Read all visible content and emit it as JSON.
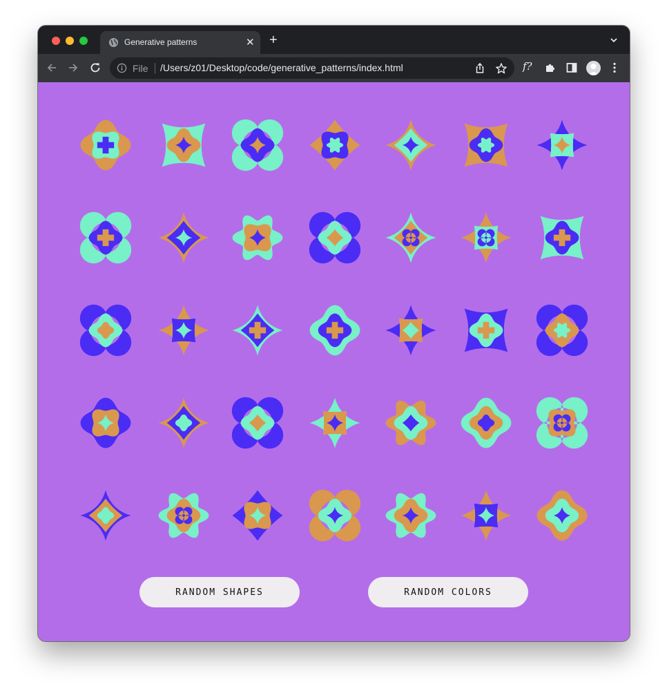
{
  "browser": {
    "tab_title": "Generative patterns",
    "tab_icon": "globe-icon",
    "url_scheme_label": "File",
    "url": "/Users/z01/Desktop/code/generative_patterns/index.html",
    "font_extension_label": "f?"
  },
  "colors": {
    "background": "#b46de9",
    "blue": "#4a2cf5",
    "mint": "#78f0c8",
    "orange": "#d9984e"
  },
  "grid": {
    "rows": 5,
    "columns": 7,
    "patterns": [
      [
        "blob",
        "orange",
        "mint",
        "blue",
        "plus"
      ],
      [
        "square",
        "mint",
        "orange",
        "blue",
        "star"
      ],
      [
        "clover",
        "mint",
        "blue",
        "orange",
        "star"
      ],
      [
        "diamond",
        "orange",
        "blue",
        "mint",
        "flower"
      ],
      [
        "star",
        "orange",
        "mint",
        "blue",
        "star"
      ],
      [
        "square",
        "orange",
        "blue",
        "mint",
        "flower"
      ],
      [
        "star",
        "blue",
        "mint",
        "orange",
        "star"
      ],
      [
        "clover",
        "mint",
        "blue",
        "orange",
        "plus"
      ],
      [
        "star",
        "orange",
        "blue",
        "mint",
        "star"
      ],
      [
        "flower",
        "mint",
        "orange",
        "blue",
        "star"
      ],
      [
        "clover",
        "blue",
        "mint",
        "orange",
        "diamond"
      ],
      [
        "star",
        "mint",
        "orange",
        "blue",
        "clover"
      ],
      [
        "star",
        "orange",
        "mint",
        "blue",
        "clover"
      ],
      [
        "square",
        "mint",
        "blue",
        "orange",
        "plus"
      ],
      [
        "clover",
        "blue",
        "mint",
        "orange",
        "blob"
      ],
      [
        "star",
        "orange",
        "blue",
        "mint",
        "star"
      ],
      [
        "star",
        "mint",
        "blue",
        "orange",
        "plus"
      ],
      [
        "blob",
        "mint",
        "blue",
        "orange",
        "plus"
      ],
      [
        "star",
        "blue",
        "orange",
        "mint",
        "diamond"
      ],
      [
        "square",
        "blue",
        "mint",
        "orange",
        "plus"
      ],
      [
        "clover",
        "blue",
        "orange",
        "mint",
        "flower"
      ],
      [
        "blob",
        "blue",
        "orange",
        "mint",
        "star"
      ],
      [
        "star",
        "orange",
        "blue",
        "mint",
        "blob"
      ],
      [
        "clover",
        "blue",
        "mint",
        "orange",
        "diamond"
      ],
      [
        "star",
        "mint",
        "orange",
        "blue",
        "star"
      ],
      [
        "flower",
        "orange",
        "mint",
        "blue",
        "diamond"
      ],
      [
        "blob",
        "mint",
        "orange",
        "blue",
        "blob"
      ],
      [
        "clover",
        "mint",
        "orange",
        "blue",
        "clover"
      ],
      [
        "star",
        "blue",
        "orange",
        "mint",
        "blob"
      ],
      [
        "flower",
        "mint",
        "orange",
        "blue",
        "clover"
      ],
      [
        "diamond",
        "blue",
        "orange",
        "mint",
        "star"
      ],
      [
        "clover",
        "orange",
        "mint",
        "blue",
        "star"
      ],
      [
        "flower",
        "mint",
        "orange",
        "blue",
        "star"
      ],
      [
        "star",
        "orange",
        "blue",
        "mint",
        "star"
      ],
      [
        "blob",
        "orange",
        "mint",
        "blue",
        "star"
      ]
    ]
  },
  "buttons": {
    "random_shapes": "RANDOM SHAPES",
    "random_colors": "RANDOM COLORS"
  }
}
